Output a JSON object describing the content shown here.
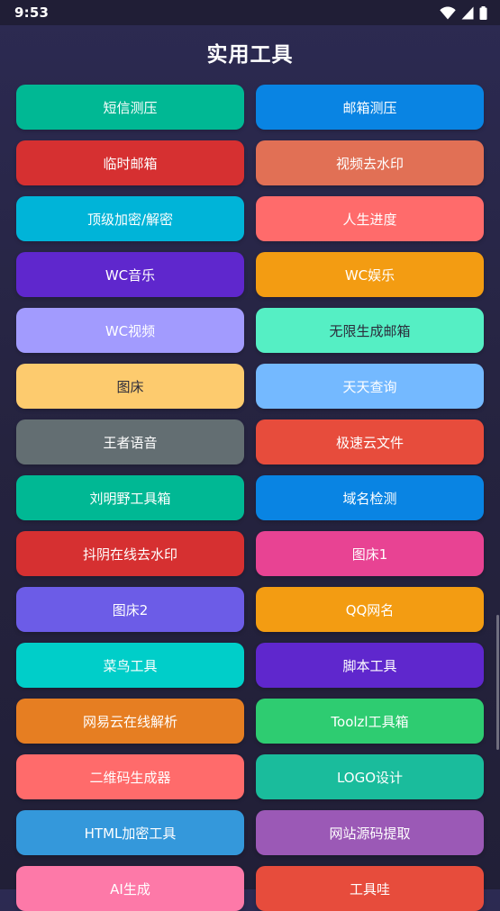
{
  "status_bar": {
    "time": "9:53"
  },
  "page": {
    "title": "实用工具"
  },
  "tools": [
    {
      "label": "短信测压",
      "color": "#00b894"
    },
    {
      "label": "邮箱测压",
      "color": "#0984e3"
    },
    {
      "label": "临时邮箱",
      "color": "#d63031"
    },
    {
      "label": "视频去水印",
      "color": "#e17055"
    },
    {
      "label": "顶级加密/解密",
      "color": "#00b4d8"
    },
    {
      "label": "人生进度",
      "color": "#ff6b6b"
    },
    {
      "label": "WC音乐",
      "color": "#5f27cd"
    },
    {
      "label": "WC娱乐",
      "color": "#f39c12"
    },
    {
      "label": "WC视频",
      "color": "#a29bfe"
    },
    {
      "label": "无限生成邮箱",
      "color": "#55efc4",
      "dark_text": true
    },
    {
      "label": "图床",
      "color": "#fdcb6e",
      "dark_text": true
    },
    {
      "label": "天天查询",
      "color": "#74b9ff"
    },
    {
      "label": "王者语音",
      "color": "#636e72"
    },
    {
      "label": "极速云文件",
      "color": "#e74c3c"
    },
    {
      "label": "刘明野工具箱",
      "color": "#00b894"
    },
    {
      "label": "域名检测",
      "color": "#0984e3"
    },
    {
      "label": "抖阴在线去水印",
      "color": "#d63031"
    },
    {
      "label": "图床1",
      "color": "#e84393"
    },
    {
      "label": "图床2",
      "color": "#6c5ce7"
    },
    {
      "label": "QQ网名",
      "color": "#f39c12"
    },
    {
      "label": "菜鸟工具",
      "color": "#00cec9"
    },
    {
      "label": "脚本工具",
      "color": "#5f27cd"
    },
    {
      "label": "网易云在线解析",
      "color": "#e67e22"
    },
    {
      "label": "Toolzl工具箱",
      "color": "#2ecc71"
    },
    {
      "label": "二维码生成器",
      "color": "#ff6b6b"
    },
    {
      "label": "LOGO设计",
      "color": "#1abc9c"
    },
    {
      "label": "HTML加密工具",
      "color": "#3498db"
    },
    {
      "label": "网站源码提取",
      "color": "#9b59b6"
    },
    {
      "label": "AI生成",
      "color": "#fd79a8"
    },
    {
      "label": "工具哇",
      "color": "#e74c3c"
    }
  ]
}
